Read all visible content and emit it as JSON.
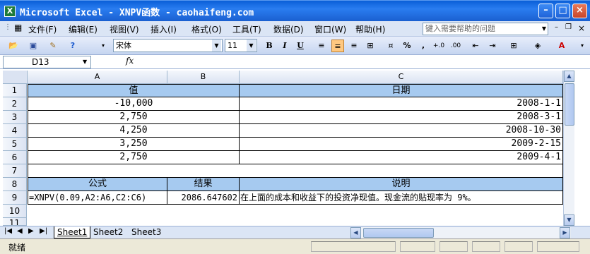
{
  "window": {
    "title": "Microsoft Excel - XNPV函数 - caohaifeng.com",
    "minimize": "–",
    "maximize": "□",
    "close": "×"
  },
  "menu": {
    "items": [
      "文件(F)",
      "编辑(E)",
      "视图(V)",
      "插入(I)",
      "格式(O)",
      "工具(T)",
      "数据(D)",
      "窗口(W)",
      "帮助(H)"
    ],
    "help_placeholder": "键入需要帮助的问题"
  },
  "toolbar": {
    "font_name": "宋体",
    "font_size": "11",
    "bold": "B",
    "italic": "I",
    "underline": "U",
    "percent": "%",
    "comma": ","
  },
  "formula_bar": {
    "name_box": "D13",
    "fx": "fx",
    "formula": ""
  },
  "grid": {
    "columns": [
      "A",
      "B",
      "C"
    ],
    "rows": [
      "1",
      "2",
      "3",
      "4",
      "5",
      "6",
      "7",
      "8",
      "9",
      "10",
      "11"
    ],
    "cells": {
      "A1": "值",
      "C1": "日期",
      "A2": "-10,000",
      "C2": "2008-1-1",
      "A3": "2,750",
      "C3": "2008-3-1",
      "A4": "4,250",
      "C4": "2008-10-30",
      "A5": "3,250",
      "C5": "2009-2-15",
      "A6": "2,750",
      "C6": "2009-4-1",
      "A8": "公式",
      "B8": "结果",
      "C8": "说明",
      "A9": "=XNPV(0.09,A2:A6,C2:C6)",
      "B9": "2086.647602",
      "C9": "在上面的成本和收益下的投资净现值。现金流的贴现率为 9%。"
    },
    "header_fill": "#a6caf0"
  },
  "sheets": {
    "tabs": [
      "Sheet1",
      "Sheet2",
      "Sheet3"
    ],
    "active": "Sheet1"
  },
  "status": {
    "text": "就绪"
  }
}
